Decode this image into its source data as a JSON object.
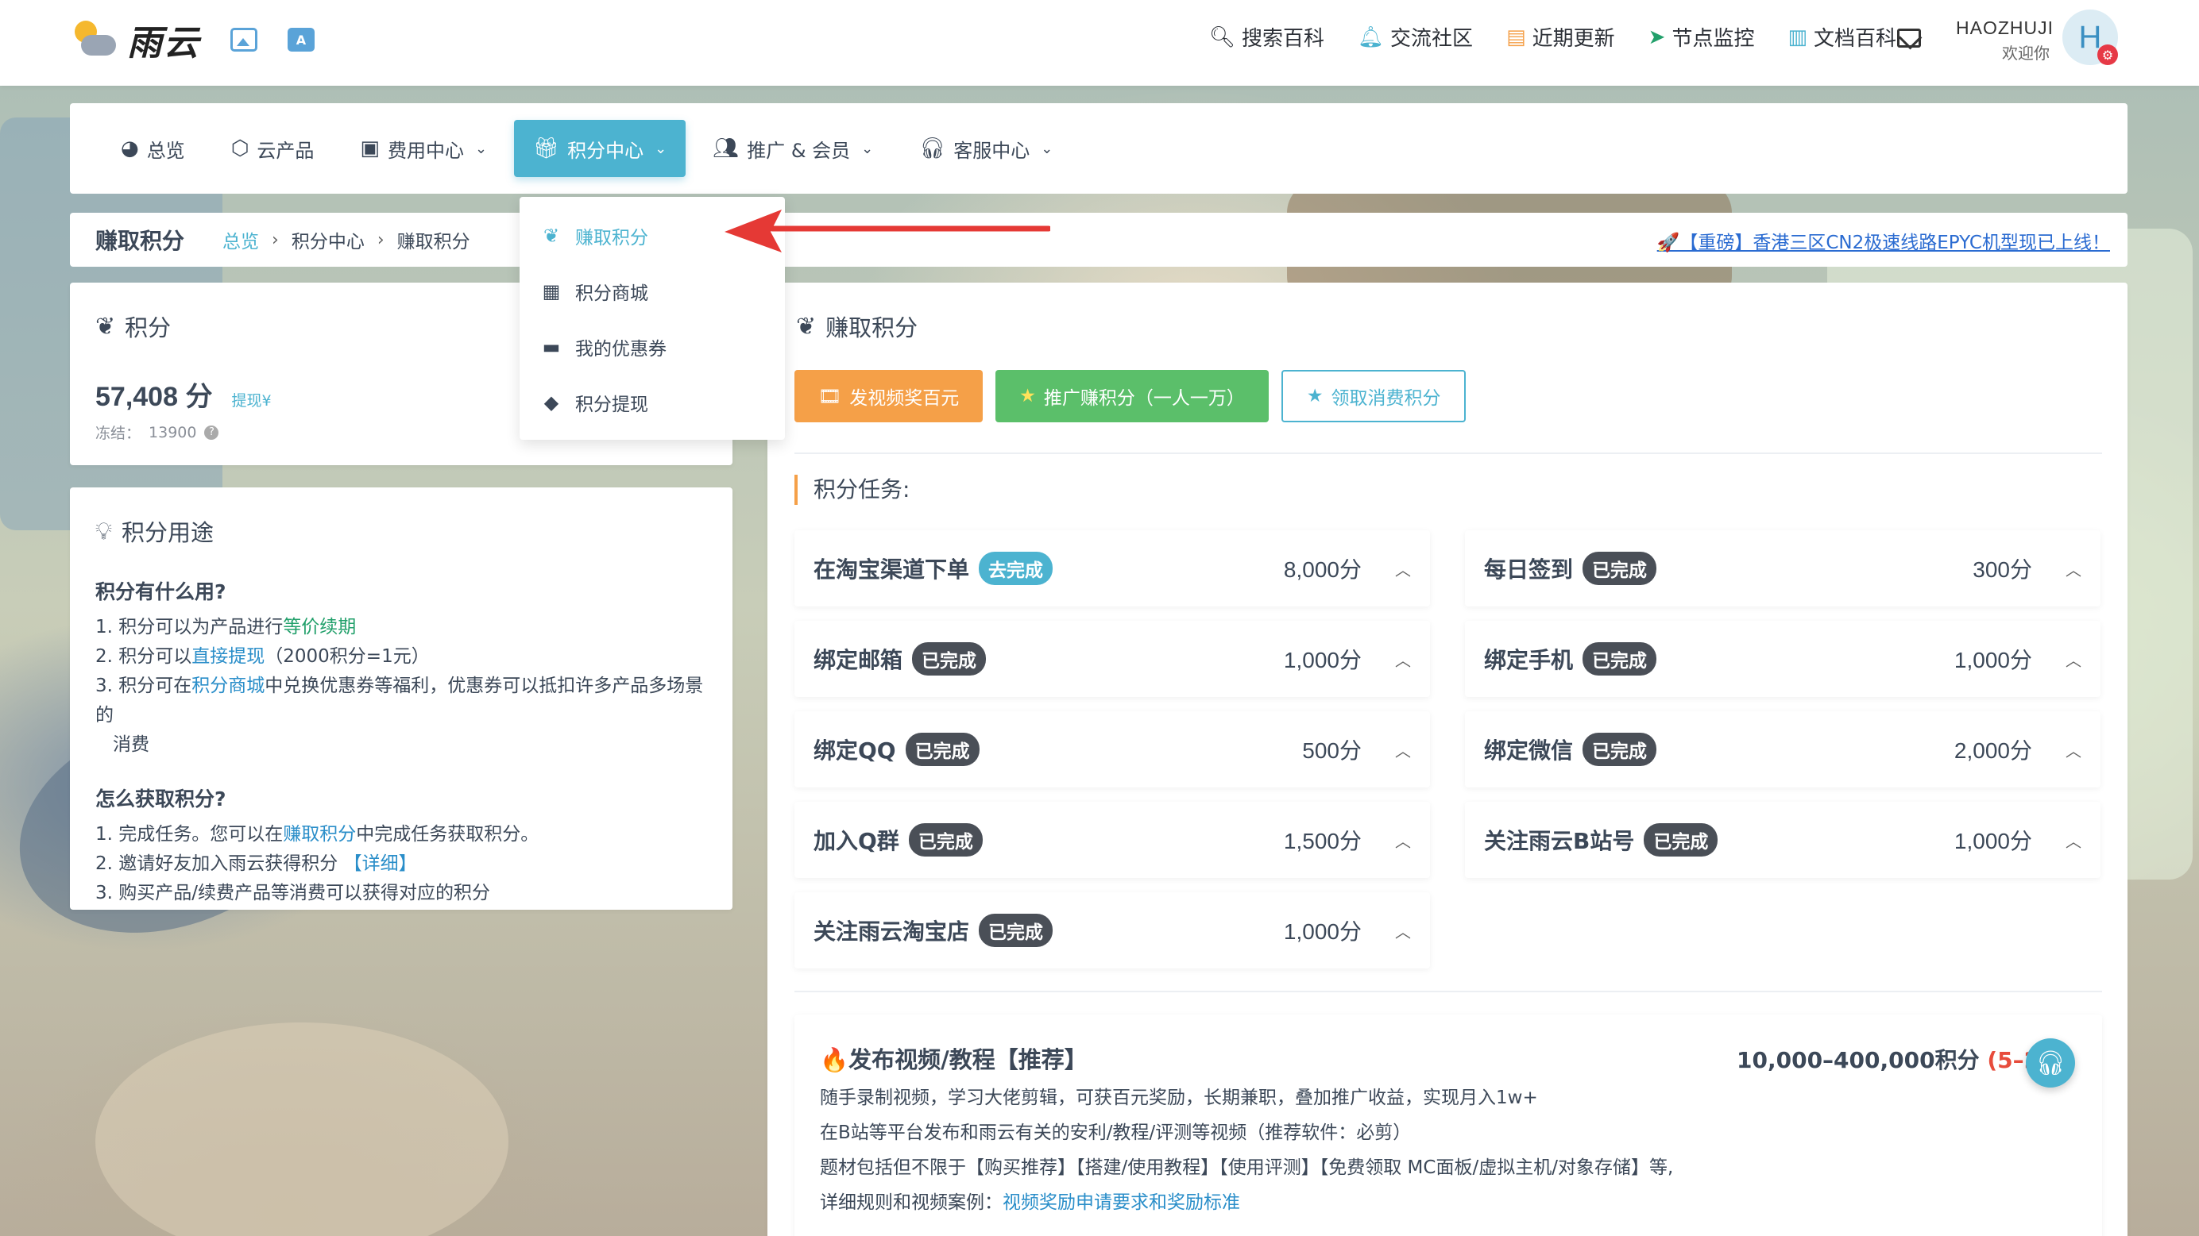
{
  "header": {
    "logo_text": "雨云",
    "nav": [
      {
        "label": "搜索百科",
        "icon": "search-icon"
      },
      {
        "label": "交流社区",
        "icon": "bell-icon"
      },
      {
        "label": "近期更新",
        "icon": "doc-icon"
      },
      {
        "label": "节点监控",
        "icon": "send-icon"
      },
      {
        "label": "文档百科",
        "icon": "book-icon"
      }
    ],
    "user": {
      "name": "HAOZHUJI",
      "welcome": "欢迎你",
      "avatar_letter": "H"
    }
  },
  "mainnav": [
    {
      "label": "总览",
      "icon": "dashboard-icon",
      "has_dropdown": false,
      "active": false
    },
    {
      "label": "云产品",
      "icon": "cubes-icon",
      "has_dropdown": false,
      "active": false
    },
    {
      "label": "费用中心",
      "icon": "money-icon",
      "has_dropdown": true,
      "active": false
    },
    {
      "label": "积分中心",
      "icon": "gift-icon",
      "has_dropdown": true,
      "active": true
    },
    {
      "label": "推广 & 会员",
      "icon": "users-icon",
      "has_dropdown": true,
      "active": false
    },
    {
      "label": "客服中心",
      "icon": "headset-icon",
      "has_dropdown": true,
      "active": false
    }
  ],
  "dropdown": [
    {
      "label": "赚取积分",
      "icon": "lotus-icon",
      "active": true
    },
    {
      "label": "积分商城",
      "icon": "store-icon",
      "active": false
    },
    {
      "label": "我的优惠券",
      "icon": "ticket-icon",
      "active": false
    },
    {
      "label": "积分提现",
      "icon": "diamond-icon",
      "active": false
    }
  ],
  "breadcrumb": {
    "title": "赚取积分",
    "items": [
      "总览",
      "积分中心",
      "赚取积分"
    ],
    "notice": "🚀【重磅】香港三区CN2极速线路EPYC机型现已上线！"
  },
  "points_card": {
    "title": "积分",
    "value": "57,408 分",
    "withdraw_label": "提现¥",
    "frozen_label": "冻结：",
    "frozen_value": "13900"
  },
  "usage_card": {
    "title": "积分用途",
    "heading1": "积分有什么用?",
    "heading2": "怎么获取积分?",
    "use1_pre": "1. 积分可以为产品进行",
    "use1_link": "等价续期",
    "use2_pre": "2. 积分可以",
    "use2_link": "直接提现",
    "use2_post": "（2000积分=1元）",
    "use3_pre": "3. 积分可在",
    "use3_link": "积分商城",
    "use3_post": "中兑换优惠券等福利，优惠券可以抵扣许多产品多场景的",
    "use3_wrap": "消费",
    "get1_pre": "1. 完成任务。您可以在",
    "get1_link": "赚取积分",
    "get1_post": "中完成任务获取积分。",
    "get2_pre": "2. 邀请好友加入雨云获得积分 ",
    "get2_link": "【详细】",
    "get3": "3. 购买产品/续费产品等消费可以获得对应的积分"
  },
  "earn_card": {
    "title": "赚取积分",
    "buttons": [
      {
        "label": "发视频奖百元",
        "icon": "film-icon",
        "style": "orange"
      },
      {
        "label": "推广赚积分（一人一万）",
        "icon": "star-icon",
        "style": "green"
      },
      {
        "label": "领取消费积分",
        "icon": "star-icon",
        "style": "outline"
      }
    ],
    "tasks_label": "积分任务:",
    "tasks": [
      {
        "name": "在淘宝渠道下单",
        "status": "去完成",
        "points": "8,000分",
        "done": false
      },
      {
        "name": "每日签到",
        "status": "已完成",
        "points": "300分",
        "done": true
      },
      {
        "name": "绑定邮箱",
        "status": "已完成",
        "points": "1,000分",
        "done": true
      },
      {
        "name": "绑定手机",
        "status": "已完成",
        "points": "1,000分",
        "done": true
      },
      {
        "name": "绑定QQ",
        "status": "已完成",
        "points": "500分",
        "done": true
      },
      {
        "name": "绑定微信",
        "status": "已完成",
        "points": "2,000分",
        "done": true
      },
      {
        "name": "加入Q群",
        "status": "已完成",
        "points": "1,500分",
        "done": true
      },
      {
        "name": "关注雨云B站号",
        "status": "已完成",
        "points": "1,000分",
        "done": true
      },
      {
        "name": "关注雨云淘宝店",
        "status": "已完成",
        "points": "1,000分",
        "done": true
      }
    ],
    "promo": {
      "title": "🔥发布视频/教程【推荐】",
      "reward": "10,000–400,000积分",
      "reward_extra": "(5–200元)",
      "line1": "随手录制视频，学习大佬剪辑，可获百元奖励，长期兼职，叠加推广收益，实现月入1w+",
      "line2": "在B站等平台发布和雨云有关的安利/教程/评测等视频（推荐软件：必剪）",
      "line3": "题材包括但不限于【购买推荐】【搭建/使用教程】【使用评测】【免费领取 MC面板/虚拟主机/对象存储】等,",
      "line4_pre": "详细规则和视频案例：",
      "line4_link": "视频奖励申请要求和奖励标准"
    }
  }
}
